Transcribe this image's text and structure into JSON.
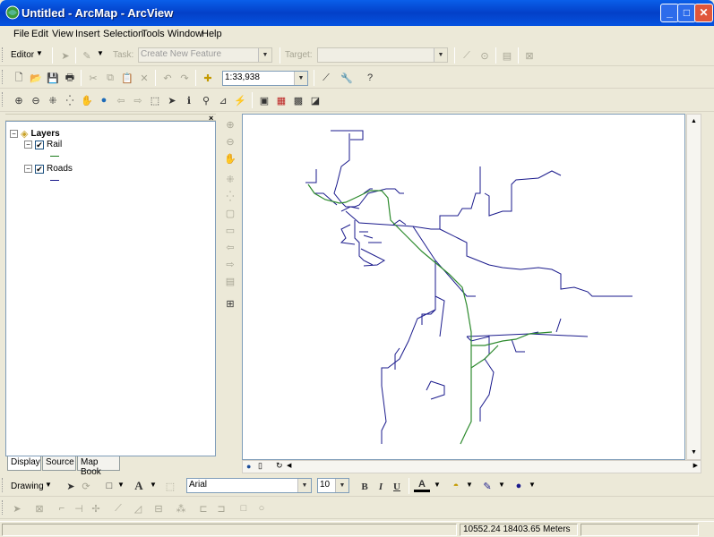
{
  "window": {
    "title": "Untitled - ArcMap - ArcView"
  },
  "menu": [
    "File",
    "Edit",
    "View",
    "Insert",
    "Selection",
    "Tools",
    "Window",
    "Help"
  ],
  "editor_toolbar": {
    "editor_label": "Editor",
    "task_label": "Task:",
    "task_value": "Create New Feature",
    "target_label": "Target:",
    "target_value": ""
  },
  "standard_toolbar": {
    "scale": "1:33,938"
  },
  "toc": {
    "root": "Layers",
    "layers": [
      {
        "name": "Rail",
        "checked": "✔",
        "color": "#008000"
      },
      {
        "name": "Roads",
        "checked": "✔",
        "color": "#00007F"
      }
    ]
  },
  "tabs": [
    "Display",
    "Source",
    "Map Book"
  ],
  "drawing_toolbar": {
    "drawing_label": "Drawing",
    "font": "Arial",
    "font_size": "10",
    "bold": "B",
    "italic": "I",
    "underline": "U",
    "text_tool": "A"
  },
  "status": {
    "coordinates": "10552.24  18403.65 Meters"
  },
  "colors": {
    "rail": "#2E8B2E",
    "roads": "#1A1A8C",
    "titlebar": "#0A5FEA"
  }
}
